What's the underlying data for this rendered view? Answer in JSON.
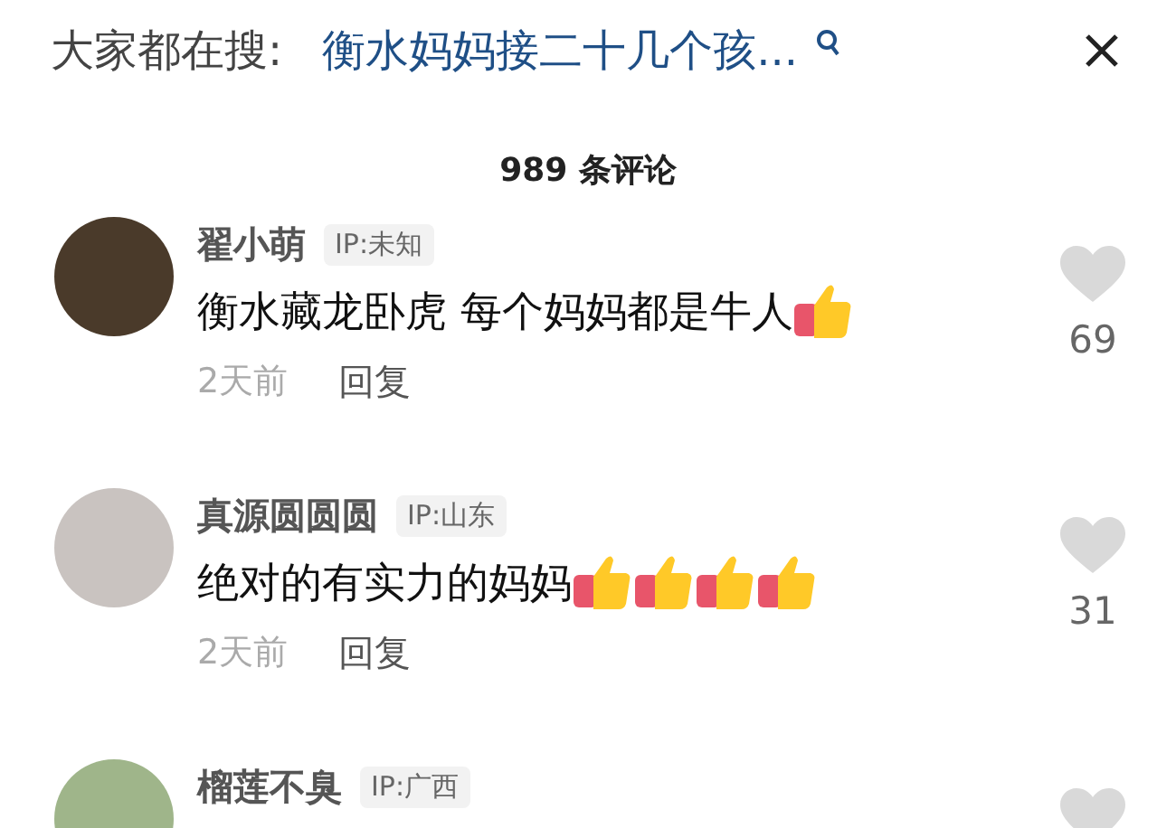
{
  "search_bar": {
    "label": "大家都在搜:",
    "query": "衡水妈妈接二十几个孩..."
  },
  "comment_count": "989 条评论",
  "comments": [
    {
      "name": "翟小萌",
      "ip": "IP:未知",
      "text": "衡水藏龙卧虎 每个妈妈都是牛人",
      "emojis": [
        {
          "kind": "thumbs-up"
        }
      ],
      "time": "2天前",
      "reply": "回复",
      "likes": "69"
    },
    {
      "name": "真源圆圆圆",
      "ip": "IP:山东",
      "text": "绝对的有实力的妈妈",
      "emojis": [
        {
          "kind": "thumbs-up"
        },
        {
          "kind": "thumbs-up"
        },
        {
          "kind": "thumbs-up"
        },
        {
          "kind": "thumbs-up"
        }
      ],
      "time": "2天前",
      "reply": "回复",
      "likes": "31"
    },
    {
      "name": "榴莲不臭",
      "ip": "IP:广西"
    }
  ]
}
